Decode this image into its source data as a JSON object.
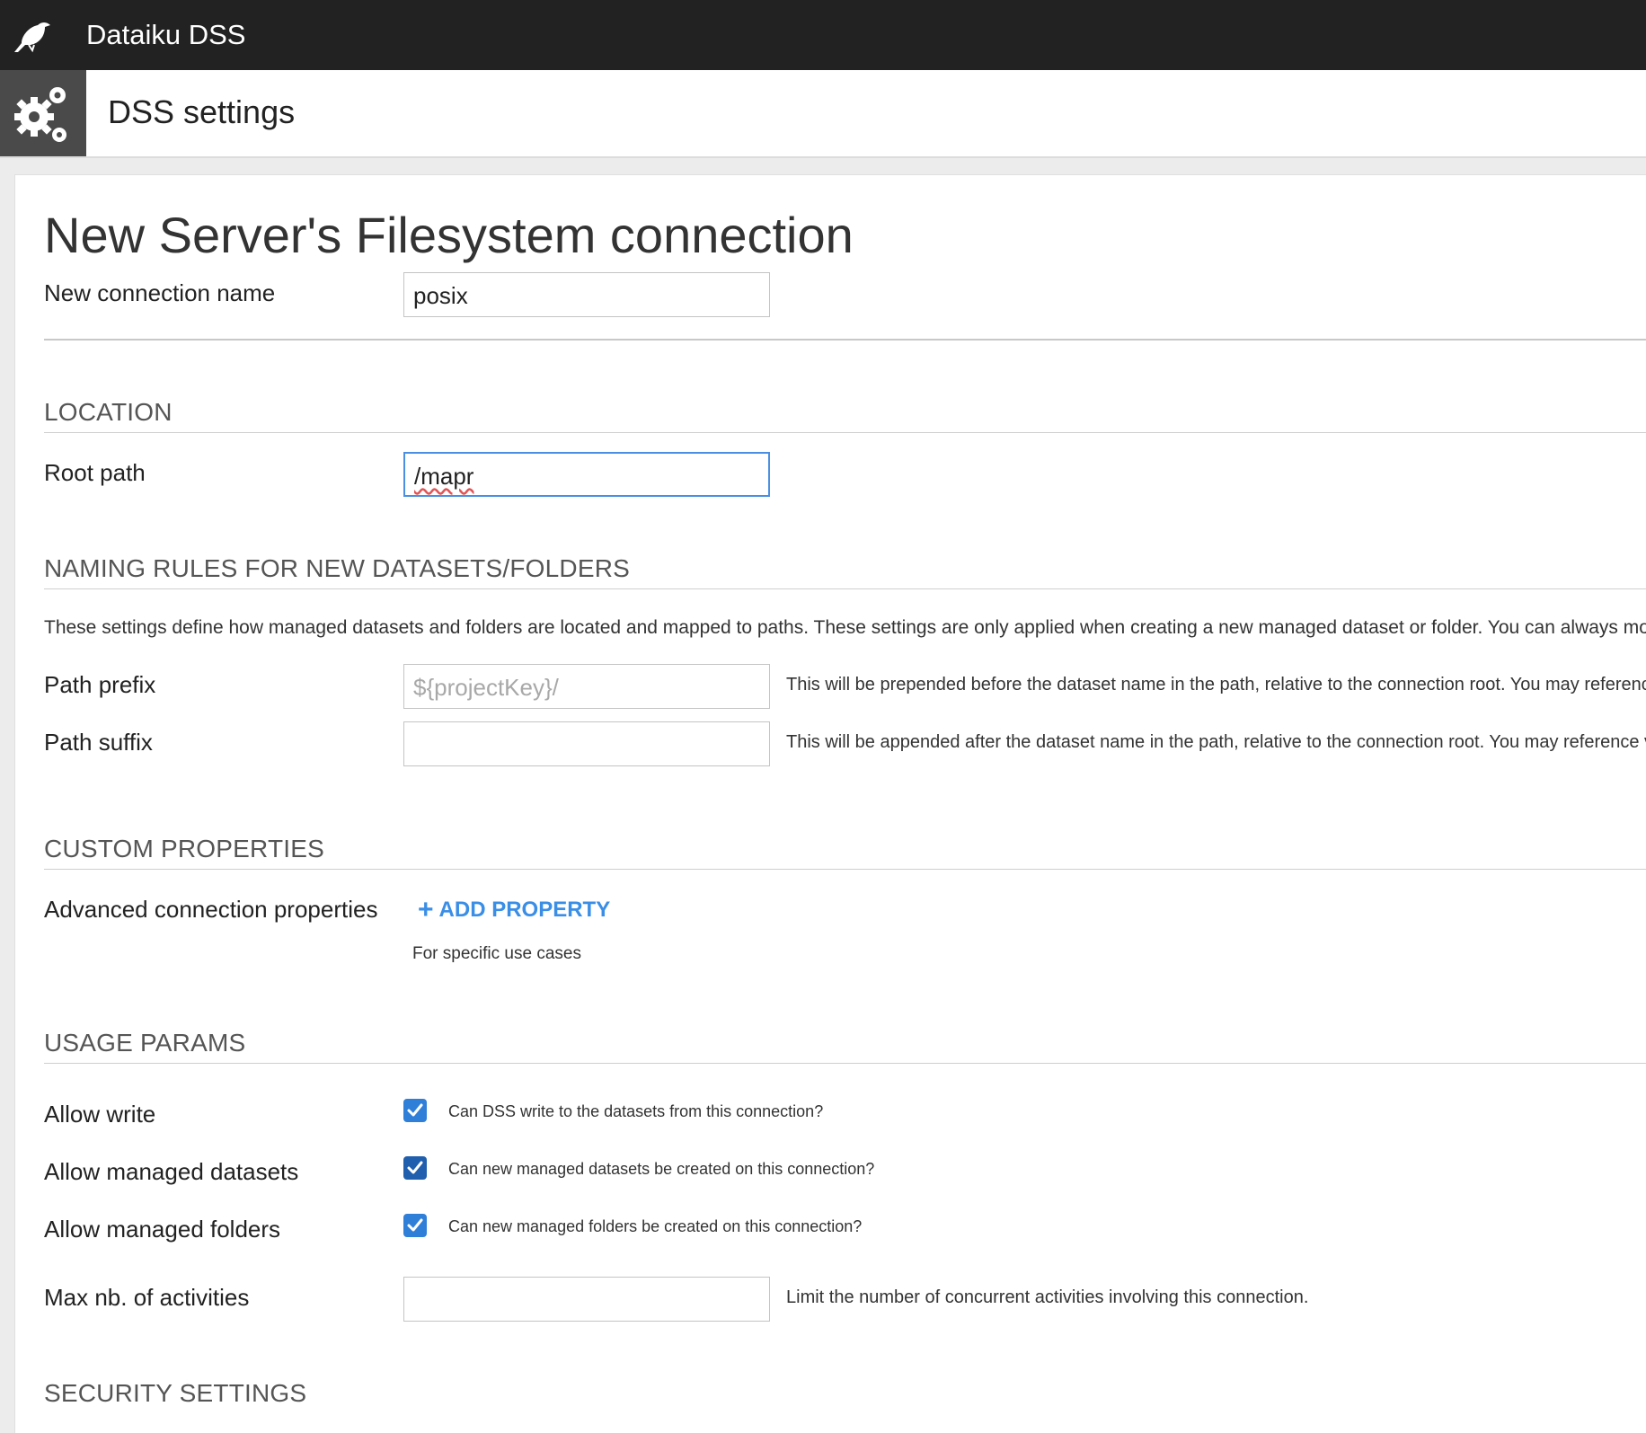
{
  "app": {
    "title": "Dataiku DSS"
  },
  "header": {
    "title": "DSS settings"
  },
  "form": {
    "heading": "New Server's Filesystem connection",
    "connection_name_label": "New connection name",
    "connection_name_value": "posix",
    "location": {
      "section_title": "LOCATION",
      "root_path_label": "Root path",
      "root_path_value": "/mapr"
    },
    "naming": {
      "section_title": "NAMING RULES FOR NEW DATASETS/FOLDERS",
      "description": "These settings define how managed datasets and folders are located and mapped to paths. These settings are only applied when creating a new managed dataset or folder. You can always modify",
      "path_prefix_label": "Path prefix",
      "path_prefix_placeholder": "${projectKey}/",
      "path_prefix_help": "This will be prepended before the dataset name in the path, relative to the connection root. You may reference v",
      "path_suffix_label": "Path suffix",
      "path_suffix_value": "",
      "path_suffix_help": "This will be appended after the dataset name in the path, relative to the connection root. You may reference var"
    },
    "custom": {
      "section_title": "CUSTOM PROPERTIES",
      "advanced_label": "Advanced connection properties",
      "add_property_label": "ADD PROPERTY",
      "add_property_help": "For specific use cases"
    },
    "usage": {
      "section_title": "USAGE PARAMS",
      "allow_write_label": "Allow write",
      "allow_write_checked": true,
      "allow_write_help": "Can DSS write to the datasets from this connection?",
      "allow_datasets_label": "Allow managed datasets",
      "allow_datasets_checked": true,
      "allow_datasets_help": "Can new managed datasets be created on this connection?",
      "allow_folders_label": "Allow managed folders",
      "allow_folders_checked": true,
      "allow_folders_help": "Can new managed folders be created on this connection?",
      "max_activities_label": "Max nb. of activities",
      "max_activities_value": "",
      "max_activities_help": "Limit the number of concurrent activities involving this connection."
    },
    "security": {
      "section_title": "SECURITY SETTINGS"
    }
  },
  "colors": {
    "topbar": "#222222",
    "accent": "#3a8ee6",
    "checkbox": "#2f7fd9"
  },
  "icons": {
    "logo": "dataiku-bird-icon",
    "settings": "gears-icon",
    "add": "plus-icon",
    "check": "check-icon"
  }
}
